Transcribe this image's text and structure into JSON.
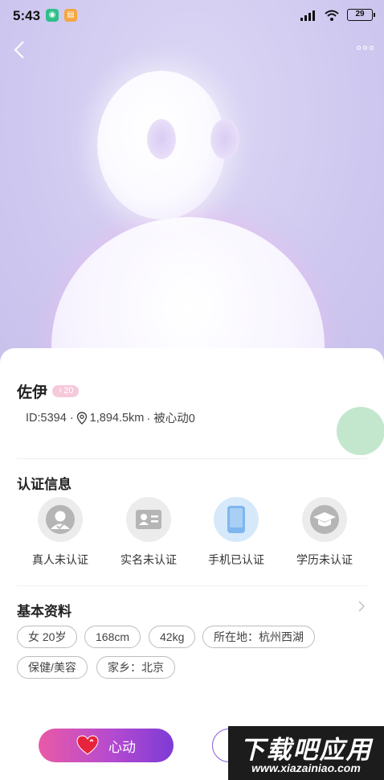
{
  "status_bar": {
    "time": "5:43",
    "battery": "29"
  },
  "profile": {
    "name": "佐伊",
    "age_badge": "♀20",
    "id_text": "ID:5394 ·",
    "distance": "1,894.5km",
    "liked_text": "· 被心动0"
  },
  "certification": {
    "title": "认证信息",
    "items": [
      {
        "label": "真人未认证",
        "icon": "person-icon",
        "verified": false
      },
      {
        "label": "实名未认证",
        "icon": "id-card-icon",
        "verified": false
      },
      {
        "label": "手机已认证",
        "icon": "phone-icon",
        "verified": true
      },
      {
        "label": "学历未认证",
        "icon": "graduation-cap-icon",
        "verified": false
      }
    ]
  },
  "basic_info": {
    "title": "基本资料",
    "tags": [
      "女 20岁",
      "168cm",
      "42kg",
      "所在地：杭州西湖",
      "保健/美容",
      "家乡：北京"
    ]
  },
  "actions": {
    "like_label": "心动"
  },
  "watermark": {
    "main": "下载吧应用",
    "sub": "www.xiazainiao.com"
  },
  "colors": {
    "accent_gradient_start": "#e95aa6",
    "accent_gradient_end": "#7d3bd6",
    "hero_bg": "#cfc9f0"
  }
}
